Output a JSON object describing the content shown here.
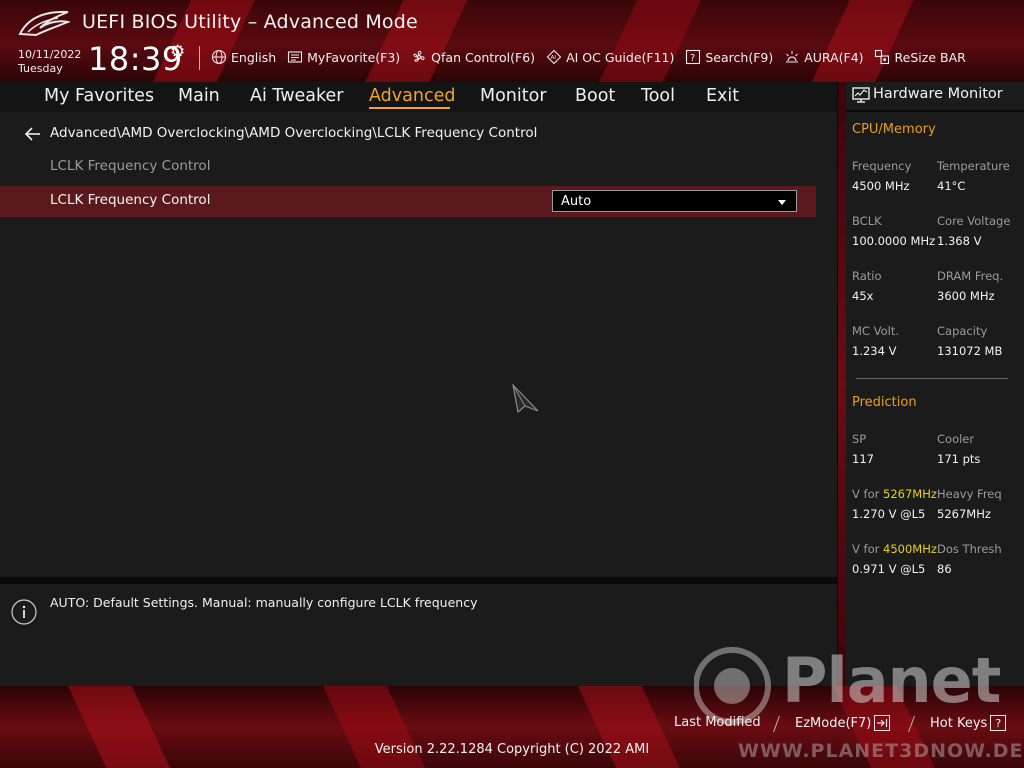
{
  "header": {
    "app_title": "UEFI BIOS Utility – Advanced Mode",
    "date": "10/11/2022",
    "day": "Tuesday",
    "time": "18:39",
    "toolbar": [
      {
        "label": "English",
        "icon": "globe-icon"
      },
      {
        "label": "MyFavorite(F3)",
        "icon": "favorite-icon"
      },
      {
        "label": "Qfan Control(F6)",
        "icon": "fan-icon"
      },
      {
        "label": "AI OC Guide(F11)",
        "icon": "ai-chip-icon"
      },
      {
        "label": "Search(F9)",
        "icon": "search-icon"
      },
      {
        "label": "AURA(F4)",
        "icon": "aura-icon"
      },
      {
        "label": "ReSize BAR",
        "icon": "resize-bar-icon"
      }
    ]
  },
  "menu": {
    "tabs": [
      {
        "label": "My Favorites"
      },
      {
        "label": "Main"
      },
      {
        "label": "Ai Tweaker"
      },
      {
        "label": "Advanced",
        "active": true
      },
      {
        "label": "Monitor"
      },
      {
        "label": "Boot"
      },
      {
        "label": "Tool"
      },
      {
        "label": "Exit"
      }
    ],
    "active_color": "#f0a61e"
  },
  "content": {
    "breadcrumb": "Advanced\\AMD Overclocking\\AMD Overclocking\\LCLK Frequency Control",
    "section_label": "LCLK Frequency Control",
    "setting": {
      "label": "LCLK Frequency Control",
      "value": "Auto"
    }
  },
  "help": {
    "text": "AUTO: Default Settings. Manual: manually configure LCLK frequency"
  },
  "hardware_monitor": {
    "title": "Hardware Monitor",
    "cpu_memory": {
      "section": "CPU/Memory",
      "items": [
        {
          "label": "Frequency",
          "value": "4500 MHz"
        },
        {
          "label": "Temperature",
          "value": "41°C"
        },
        {
          "label": "BCLK",
          "value": "100.0000 MHz"
        },
        {
          "label": "Core Voltage",
          "value": "1.368 V"
        },
        {
          "label": "Ratio",
          "value": "45x"
        },
        {
          "label": "DRAM Freq.",
          "value": "3600 MHz"
        },
        {
          "label": "MC Volt.",
          "value": "1.234 V"
        },
        {
          "label": "Capacity",
          "value": "131072 MB"
        }
      ]
    },
    "prediction": {
      "section": "Prediction",
      "sp_label": "SP",
      "sp_value": "117",
      "cooler_label": "Cooler",
      "cooler_value": "171 pts",
      "v_for_label": "V for",
      "freq_1": "5267MHz",
      "v_1": "1.270 V @L5",
      "heavy_label": "Heavy Freq",
      "heavy_value": "5267MHz",
      "freq_2": "4500MHz",
      "v_2": "0.971 V @L5",
      "dos_label": "Dos Thresh",
      "dos_value": "86"
    },
    "section_color": "#e89f1c",
    "highlight_color": "#e6d21a"
  },
  "footer": {
    "last_modified": "Last Modified",
    "ezmode": "EzMode(F7)",
    "hotkeys": "Hot Keys",
    "hotkeys_key": "?",
    "version": "Version 2.22.1284 Copyright (C) 2022 AMI"
  },
  "watermark": {
    "word": "Planet",
    "url": "WWW.PLANET3DNOW.DE"
  }
}
